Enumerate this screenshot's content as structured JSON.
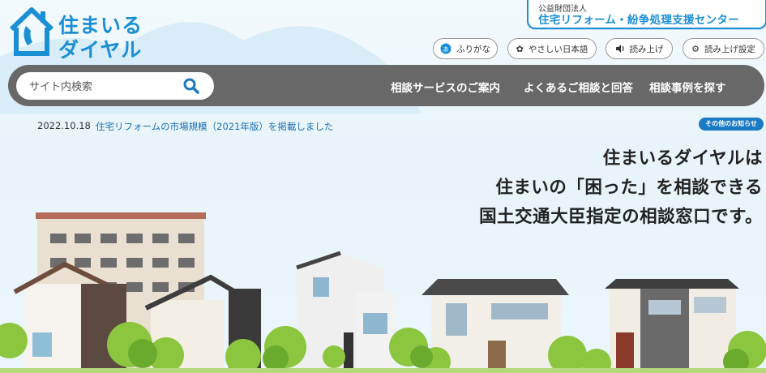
{
  "logo": {
    "line1": "住まいる",
    "line2": "ダイヤル"
  },
  "org": {
    "sub": "公益財団法人",
    "main": "住宅リフォーム・紛争処理支援センター"
  },
  "accessibility": {
    "furigana": "ふりがな",
    "easy_japanese": "やさしい日本語",
    "read_aloud": "読み上げ",
    "read_settings": "読み上げ設定"
  },
  "search": {
    "placeholder": "サイト内検索"
  },
  "nav": {
    "items": [
      "相談サービスのご案内",
      "よくあるご相談と回答",
      "相談事例を探す"
    ]
  },
  "news": {
    "date": "2022.10.18",
    "text": "住宅リフォームの市場規模（2021年版）を掲載しました",
    "more": "その他のお知らせ"
  },
  "headline": {
    "line1": "住まいるダイヤルは",
    "line2": "住まいの「困った」を相談できる",
    "line3": "国土交通大臣指定の相談窓口です。"
  },
  "colors": {
    "brand": "#1a8fd4",
    "nav_bg": "#686868",
    "link": "#1a6fb0"
  }
}
